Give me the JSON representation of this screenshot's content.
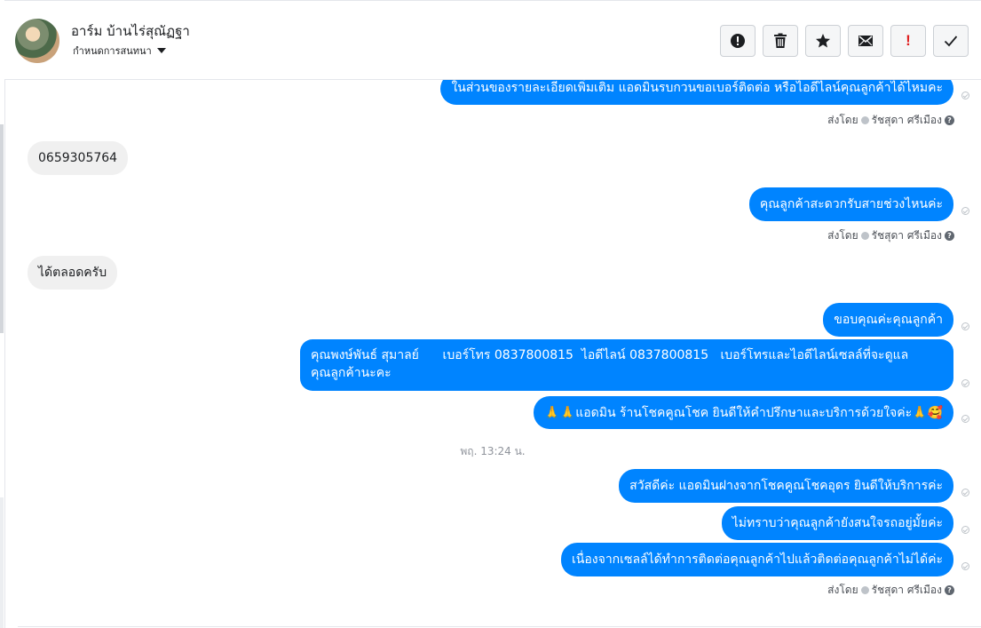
{
  "header": {
    "contact_name": "อาร์ม บ้านไร่สุณัฏฐา",
    "assign_label": "กำหนดการสนทนา",
    "actions": [
      {
        "name": "report-icon-button",
        "icon": "alert-circle-icon"
      },
      {
        "name": "delete-button",
        "icon": "trash-icon"
      },
      {
        "name": "star-button",
        "icon": "star-icon"
      },
      {
        "name": "mark-unread-button",
        "icon": "envelope-icon"
      },
      {
        "name": "follow-up-button",
        "icon": "exclamation-icon",
        "text": "!"
      },
      {
        "name": "done-button",
        "icon": "check-icon"
      }
    ]
  },
  "conversation": {
    "messages": [
      {
        "dir": "out",
        "text": "ในส่วนของรายละเอียดเพิ่มเติม แอดมินรบกวนขอเบอร์ติดต่อ หรือไอดีไลน์คุณลูกค้าได้ไหมคะ"
      },
      {
        "dir": "in",
        "text": "0659305764"
      },
      {
        "dir": "out",
        "text": "คุณลูกค้าสะดวกรับสายช่วงไหนค่ะ"
      },
      {
        "dir": "in",
        "text": "ได้ตลอดครับ"
      },
      {
        "dir": "out",
        "text": "ขอบคุณค่ะคุณลูกค้า"
      },
      {
        "dir": "out",
        "text_line1": "คุณพงษ์พันธ์ สุมาลย์      เบอร์โทร 0837800815  ไอดีไลน์ 0837800815   เบอร์โทรและไอดีไลน์เซลล์ที่จะดูแล",
        "text_line2": "คุณลูกค้านะคะ"
      },
      {
        "dir": "out",
        "text": "🙏🙏แอดมิน ร้านโชคคูณโชค ยินดีให้คำปรึกษาและบริการด้วยใจค่ะ🙏🥰"
      },
      {
        "dir": "out",
        "text": "สวัสดีค่ะ แอดมินฝางจากโชคคูณโชคอุดร ยินดีให้บริการค่ะ"
      },
      {
        "dir": "out",
        "text": "ไม่ทราบว่าคุณลูกค้ายังสนใจรถอยู่มั้ยค่ะ"
      },
      {
        "dir": "out",
        "text": "เนื่องจากเซลล์ได้ทำการติดต่อคุณลูกค้าไปแล้วติดต่อคุณลูกค้าไม่ได้ค่ะ"
      }
    ],
    "timestamp": "พฤ. 13:24 น.",
    "sent_by_prefix": "ส่งโดย",
    "sent_by_name": "รัชสุดา ศรีเมือง",
    "help_glyph": "?"
  },
  "colors": {
    "outgoing_bubble": "#0084ff",
    "incoming_bubble": "#f0f0f0",
    "follow_up_red": "#e02020"
  }
}
